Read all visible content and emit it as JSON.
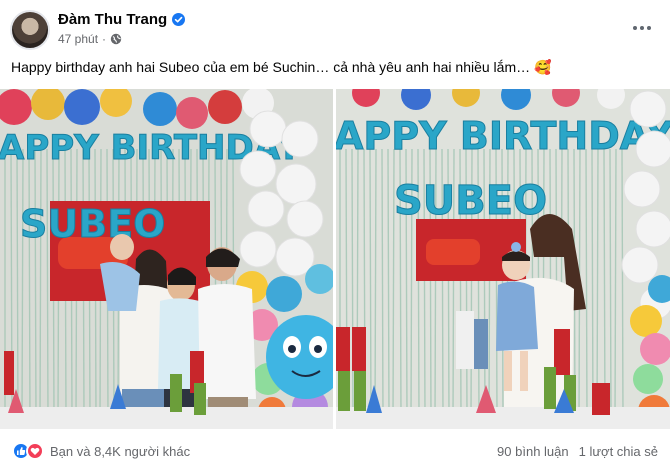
{
  "post": {
    "author": "Đàm Thu Trang",
    "time": "47 phút",
    "dot": "·",
    "caption": "Happy birthday anh hai Subeo của em bé Suchin… cả nhà yêu anh hai nhiều lắm… 🥰"
  },
  "photos": [
    {
      "banner_text": "APPY BIRTHDAY",
      "name_text": "SUBEO"
    },
    {
      "banner_text": "APPY BIRTHDAY",
      "name_text": "SUBEO"
    }
  ],
  "footer": {
    "reactions_text": "Bạn và 8,4K người khác",
    "comments": "90 bình luận",
    "shares": "1 lượt chia sẻ"
  },
  "colors": {
    "like_blue": "#1877f2",
    "love_red": "#f33e58",
    "muted_text": "#65676b",
    "balloon_teal": "#2aa6c8"
  }
}
